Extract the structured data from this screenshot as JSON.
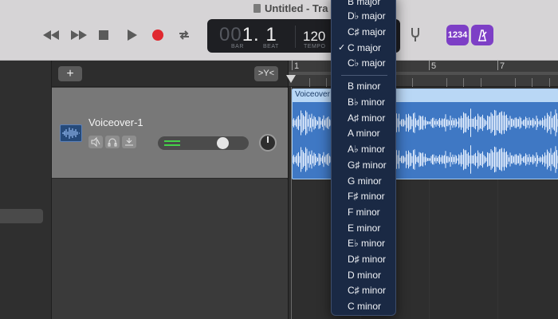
{
  "window": {
    "title": "Untitled - Tra"
  },
  "transport": {
    "lcd": {
      "bar_dim": "00",
      "bar_beat": "1. 1",
      "bar_label": "BAR",
      "beat_label": "BEAT",
      "tempo": "120",
      "tempo_label": "TEMPO"
    },
    "count_in_label": "1234"
  },
  "tracks": {
    "add_symbol": "+",
    "filter_symbol": ">Y<",
    "items": [
      {
        "name": "Voiceover-1",
        "volume_level": 0.62
      }
    ]
  },
  "timeline": {
    "bar_numbers": [
      "1",
      "5",
      "7"
    ],
    "regions": [
      {
        "name": "Voiceover"
      }
    ]
  },
  "key_menu": {
    "major_items": [
      "B major",
      "D♭ major",
      "C♯ major",
      "C major",
      "C♭ major"
    ],
    "selected": "C major",
    "check_symbol": "✓",
    "minor_items": [
      "B minor",
      "B♭ minor",
      "A♯ minor",
      "A minor",
      "A♭ minor",
      "G♯ minor",
      "G minor",
      "F♯ minor",
      "F minor",
      "E minor",
      "E♭ minor",
      "D♯ minor",
      "D minor",
      "C♯ minor",
      "C minor"
    ]
  },
  "colors": {
    "region": "#3f78c4",
    "record": "#e0282f",
    "accent_purple": "#7d3fc6",
    "menu_bg": "#1a2944"
  }
}
